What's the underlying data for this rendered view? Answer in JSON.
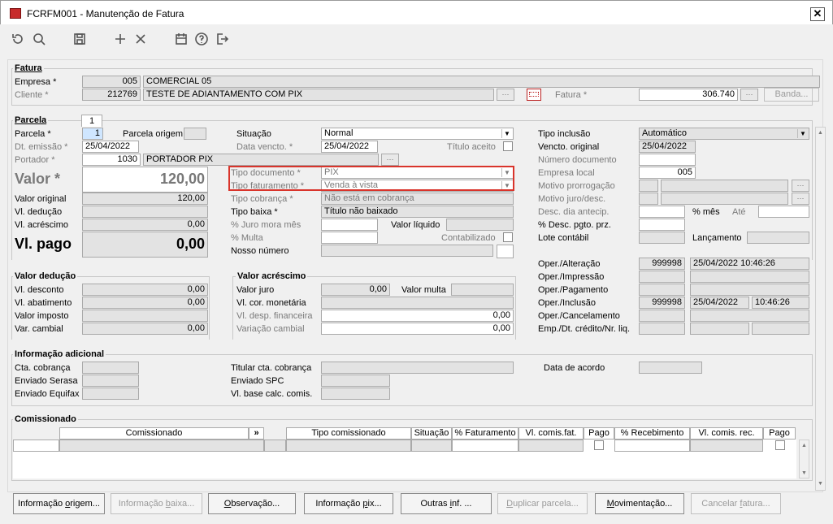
{
  "window": {
    "title": "FCRFM001 - Manutenção de Fatura",
    "close": "✕"
  },
  "toolbar": {
    "icons": [
      "undo-icon",
      "search-icon",
      "save-icon",
      "add-icon",
      "delete-icon",
      "calendar-icon",
      "help-icon",
      "exit-icon"
    ]
  },
  "fatura": {
    "group": "Fatura",
    "empresa_label": "Empresa *",
    "empresa_code": "005",
    "empresa_name": "COMERCIAL 05",
    "cliente_label": "Cliente *",
    "cliente_code": "212769",
    "cliente_name": "TESTE DE ADIANTAMENTO COM PIX",
    "fatura_label": "Fatura *",
    "fatura_value": "306.740",
    "banda_button": "Banda..."
  },
  "parcela": {
    "group": "Parcela",
    "tab": "1",
    "parcela_label": "Parcela *",
    "parcela_value": "1",
    "parcela_origem_label": "Parcela origem",
    "dt_emissao_label": "Dt. emissão *",
    "dt_emissao": "25/04/2022",
    "portador_label": "Portador *",
    "portador_code": "1030",
    "portador_name": "PORTADOR PIX",
    "valor_label": "Valor *",
    "valor": "120,00",
    "valor_original_label": "Valor original",
    "valor_original": "120,00",
    "vl_deducao_label": "Vl. dedução",
    "vl_deducao": "",
    "vl_acrescimo_label": "Vl. acréscimo",
    "vl_acrescimo": "0,00",
    "vl_pago_label": "Vl. pago",
    "vl_pago": "0,00",
    "situacao_label": "Situação",
    "situacao": "Normal",
    "dt_vencto_label": "Data vencto. *",
    "dt_vencto": "25/04/2022",
    "titulo_aceito_label": "Título aceito",
    "tipo_doc_label": "Tipo documento *",
    "tipo_doc": "PIX",
    "tipo_fat_label": "Tipo faturamento *",
    "tipo_fat": "Venda à vista",
    "tipo_cob_label": "Tipo cobrança *",
    "tipo_cob": "Não está em cobrança",
    "tipo_baixa_label": "Tipo baixa *",
    "tipo_baixa": "Título não baixado",
    "juro_mora_label": "% Juro mora mês",
    "valor_liquido_label": "Valor líquido",
    "multa_label": "% Multa",
    "contabilizado_label": "Contabilizado",
    "nosso_numero_label": "Nosso número",
    "tipo_inclusao_label": "Tipo inclusão",
    "tipo_inclusao": "Automático",
    "vencto_original_label": "Vencto. original",
    "vencto_original": "25/04/2022",
    "numero_doc_label": "Número documento",
    "empresa_local_label": "Empresa local",
    "empresa_local": "005",
    "motivo_prorrog_label": "Motivo prorrogação",
    "motivo_juro_label": "Motivo juro/desc.",
    "desc_dia_label": "Desc. dia antecip.",
    "pct_mes_label": "% mês",
    "ate_label": "Até",
    "desc_pgto_label": "% Desc. pgto. prz.",
    "lote_label": "Lote contábil",
    "lancamento_label": "Lançamento"
  },
  "deducao": {
    "group": "Valor dedução",
    "desconto_label": "Vl. desconto",
    "desconto": "0,00",
    "abatimento_label": "Vl. abatimento",
    "abatimento": "0,00",
    "imposto_label": "Valor imposto",
    "cambial_label": "Var. cambial",
    "cambial": "0,00"
  },
  "acrescimo": {
    "group": "Valor acréscimo",
    "juro_label": "Valor juro",
    "juro": "0,00",
    "multa_label": "Valor multa",
    "cor_label": "Vl. cor. monetária",
    "desp_label": "Vl. desp. financeira",
    "desp": "0,00",
    "var_label": "Variação cambial",
    "var": "0,00"
  },
  "oper": {
    "alteracao_label": "Oper./Alteração",
    "alteracao_user": "999998",
    "alteracao_dt": "25/04/2022 10:46:26",
    "impressao_label": "Oper./Impressão",
    "pagamento_label": "Oper./Pagamento",
    "inclusao_label": "Oper./Inclusão",
    "inclusao_user": "999998",
    "inclusao_dt": "25/04/2022",
    "inclusao_hr": "10:46:26",
    "cancelamento_label": "Oper./Cancelamento",
    "emp_label": "Emp./Dt. crédito/Nr. liq."
  },
  "info": {
    "group": "Informação adicional",
    "cta_label": "Cta. cobrança",
    "serasa_label": "Enviado Serasa",
    "equifax_label": "Enviado Equifax",
    "titular_label": "Titular cta. cobrança",
    "spc_label": "Enviado SPC",
    "base_label": "Vl. base calc. comis.",
    "acordo_label": "Data de acordo"
  },
  "comissionado": {
    "group": "Comissionado",
    "columns": [
      "Comissionado",
      "»",
      "Tipo comissionado",
      "Situação",
      "% Faturamento",
      "Vl. comis.fat.",
      "Pago",
      "% Recebimento",
      "Vl. comis. rec.",
      "Pago"
    ]
  },
  "buttons": [
    {
      "pre": "Informação ",
      "u": "o",
      "post": "rigem...",
      "enabled": true
    },
    {
      "pre": "Informação ",
      "u": "b",
      "post": "aixa...",
      "enabled": false
    },
    {
      "pre": "",
      "u": "O",
      "post": "bservação...",
      "enabled": true
    },
    {
      "pre": "Informação ",
      "u": "p",
      "post": "ix...",
      "enabled": true
    },
    {
      "pre": "Outras ",
      "u": "i",
      "post": "nf. ...",
      "enabled": true
    },
    {
      "pre": "",
      "u": "D",
      "post": "uplicar parcela...",
      "enabled": false
    },
    {
      "pre": "",
      "u": "M",
      "post": "ovimentação...",
      "enabled": true
    },
    {
      "pre": "Cancelar ",
      "u": "f",
      "post": "atura...",
      "enabled": false
    }
  ]
}
